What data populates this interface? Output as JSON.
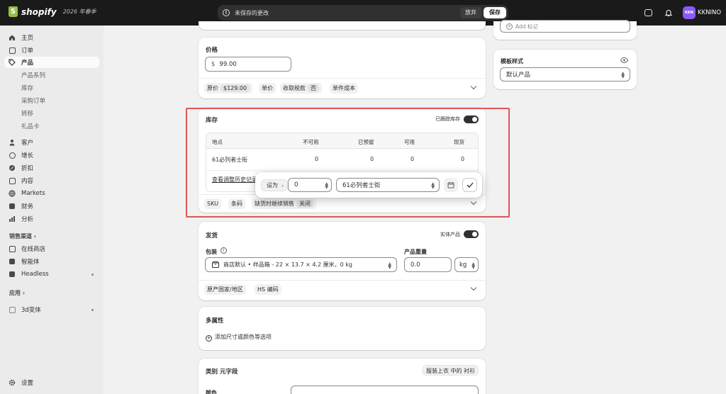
{
  "topbar": {
    "brand": "shopify",
    "edition": "2026 年春季",
    "unsaved_message": "未保存的更改",
    "discard_label": "放弃",
    "save_label": "保存",
    "avatar_initials": "KKN",
    "store_name": "KKNINO"
  },
  "sidebar": {
    "items": [
      {
        "label": "主页",
        "icon": "home-icon"
      },
      {
        "label": "订单",
        "icon": "inbox-icon"
      },
      {
        "label": "产品",
        "icon": "tag-icon",
        "active": true
      },
      {
        "label": "产品系列",
        "sub": true
      },
      {
        "label": "库存",
        "sub": true
      },
      {
        "label": "采购订单",
        "sub": true
      },
      {
        "label": "转移",
        "sub": true
      },
      {
        "label": "礼品卡",
        "sub": true
      },
      {
        "label": "客户",
        "icon": "person-icon"
      },
      {
        "label": "增长",
        "icon": "gauge-icon"
      },
      {
        "label": "折扣",
        "icon": "discount-icon"
      },
      {
        "label": "内容",
        "icon": "content-icon"
      },
      {
        "label": "Markets",
        "icon": "globe-icon"
      },
      {
        "label": "财务",
        "icon": "bank-icon"
      },
      {
        "label": "分析",
        "icon": "chart-icon"
      }
    ],
    "channels_section": "销售渠道 ›",
    "channels": [
      {
        "label": "在线商店",
        "icon": "store-icon"
      },
      {
        "label": "智能体",
        "icon": "agent-icon"
      },
      {
        "label": "Headless",
        "icon": "headless-icon"
      }
    ],
    "apps_section": "应用 ›",
    "apps": [
      {
        "label": "3d变体",
        "icon": "app-icon"
      }
    ],
    "settings_label": "设置"
  },
  "tags_card": {
    "add_tag_label": "Add 标记"
  },
  "template_card": {
    "title": "模板样式",
    "value": "默认产品"
  },
  "price_card": {
    "title": "价格",
    "currency": "$",
    "price": "99.00",
    "chips": {
      "compare_label": "原价",
      "compare_value": "$129.00",
      "unit_price": "单价",
      "tax_label": "收取税款",
      "tax_value": "否",
      "cost": "单件成本"
    }
  },
  "inventory_card": {
    "title": "库存",
    "track_label": "已跟踪库存",
    "columns": [
      "地点",
      "不可用",
      "已预留",
      "可用",
      "现货"
    ],
    "rows": [
      {
        "location": "61必列者士街",
        "unavailable": "0",
        "committed": "0",
        "available": "0",
        "on_hand": "0"
      }
    ],
    "history_link": "查看调整历史记录",
    "chips": {
      "sku": "SKU",
      "barcode": "条码",
      "oversell_label": "缺货时继续销售",
      "oversell_value": "关闭"
    }
  },
  "popover": {
    "mode": "设为",
    "quantity": "0",
    "location": "61必列者士街"
  },
  "shipping_card": {
    "title": "发货",
    "physical_label": "实体产品",
    "package_label": "包装",
    "package_value": "商店默认 • 样品箱 - 22 × 13.7 × 4.2 厘米，0 kg",
    "weight_label": "产品重量",
    "weight_value": "0.0",
    "weight_unit": "kg",
    "chips": {
      "origin": "原产国家/地区",
      "hs": "HS 编码"
    }
  },
  "variants_card": {
    "title": "多属性",
    "add_label": "添加尺寸或颜色等选项"
  },
  "metafields_card": {
    "title": "类别 元字段",
    "category_badge": "服装上衣 中的 衬衫",
    "field_label": "颜色"
  }
}
